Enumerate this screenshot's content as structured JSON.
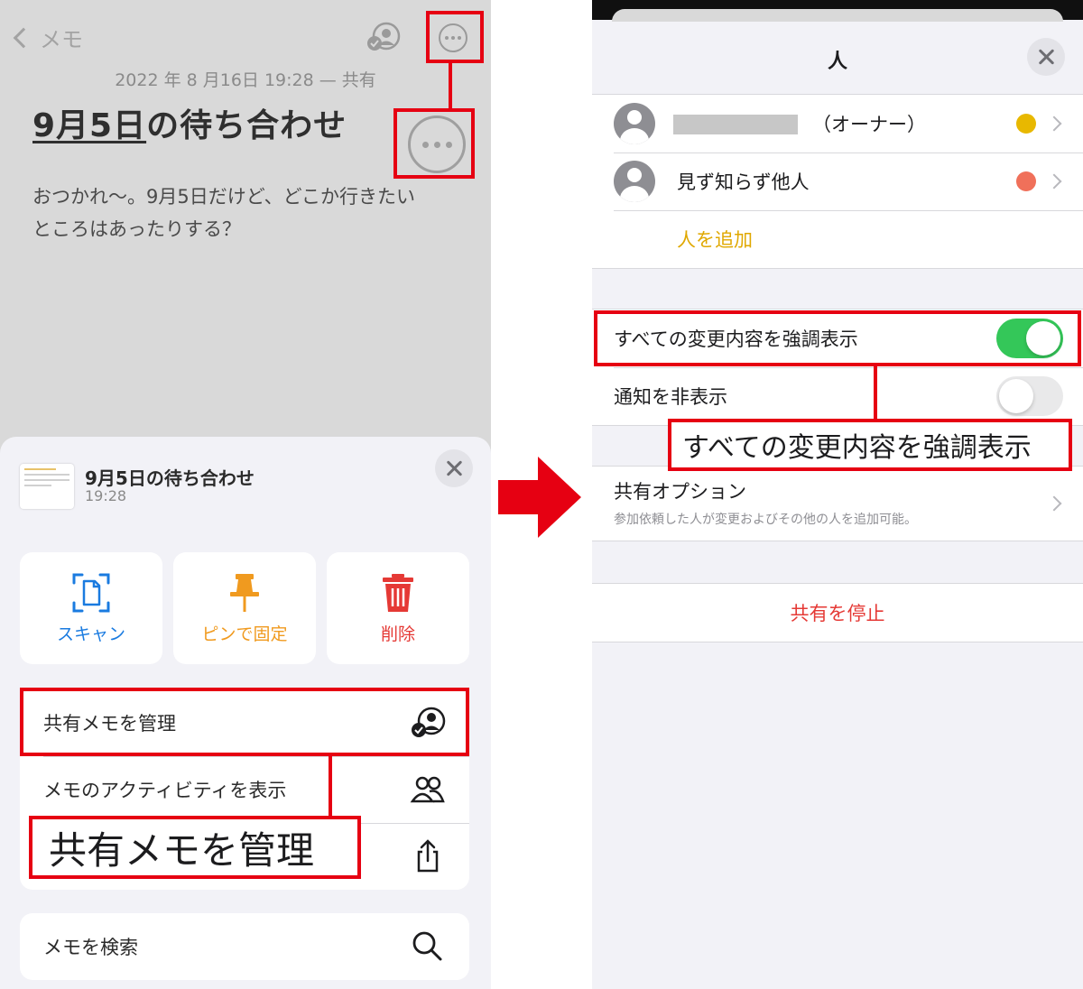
{
  "left": {
    "nav": {
      "back_label": "メモ"
    },
    "note": {
      "date_line": "2022 年 8 月16日 19:28 — 共有",
      "title": "9月5日の待ち合わせ",
      "title_underlined": "9月5日",
      "title_rest": "の待ち合わせ",
      "body_line1": "おつかれ〜。9月5日だけど、どこか行きたい",
      "body_line2": "ところはあったりする？"
    },
    "sheet": {
      "title": "9月5日の待ち合わせ",
      "time": "19:28",
      "actions": [
        {
          "label": "スキャン",
          "icon": "scan-document-icon",
          "color": "#1a7be0"
        },
        {
          "label": "ピンで固定",
          "icon": "pin-icon",
          "color": "#f09a1f"
        },
        {
          "label": "削除",
          "icon": "trash-icon",
          "color": "#e53935"
        }
      ],
      "menu": [
        {
          "label": "共有メモを管理",
          "icon": "manage-shared-note-icon"
        },
        {
          "label": "メモのアクティビティを表示",
          "icon": "people-icon"
        },
        {
          "label": "",
          "icon": "share-icon"
        }
      ],
      "menu2": [
        {
          "label": "メモを検索",
          "icon": "search-icon"
        }
      ]
    },
    "callout": "共有メモを管理"
  },
  "right": {
    "title": "人",
    "people": [
      {
        "name": "（オーナー）",
        "dot_color": "#e8b800"
      },
      {
        "name": "見ず知らず他人",
        "dot_color": "#f0705a"
      }
    ],
    "add_person": "人を追加",
    "toggles": [
      {
        "label": "すべての変更内容を強調表示",
        "on": true
      },
      {
        "label": "通知を非表示",
        "on": false
      }
    ],
    "callout": "すべての変更内容を強調表示",
    "share_options": {
      "title": "共有オプション",
      "subtitle": "参加依頼した人が変更およびその他の人を追加可能。"
    },
    "stop_sharing": "共有を停止"
  },
  "colors": {
    "highlight_red": "#e60012",
    "toggle_green": "#34c759",
    "accent_yellow": "#e0a800",
    "destructive": "#e53935"
  }
}
